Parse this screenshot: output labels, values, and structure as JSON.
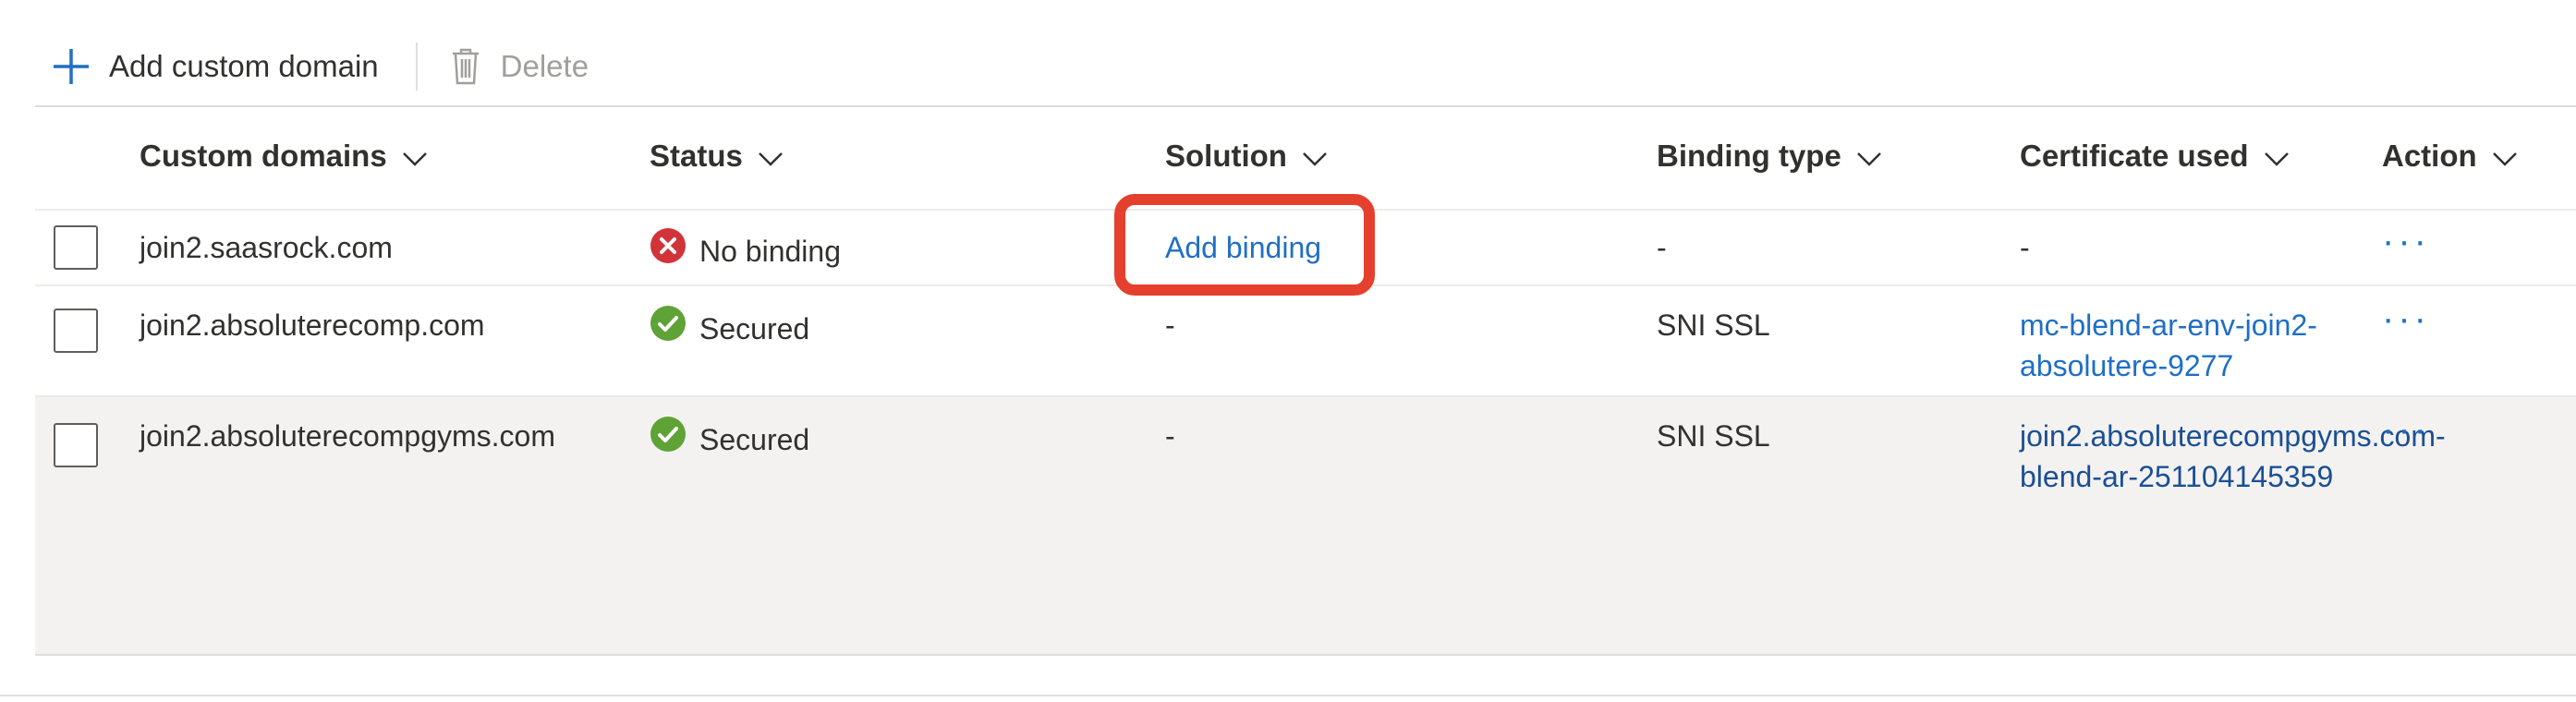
{
  "toolbar": {
    "add_label": "Add custom domain",
    "delete_label": "Delete"
  },
  "columns": {
    "domain": "Custom domains",
    "status": "Status",
    "solution": "Solution",
    "binding": "Binding type",
    "certificate": "Certificate used",
    "action": "Action"
  },
  "rows": [
    {
      "domain": "join2.saasrock.com",
      "status": "No binding",
      "status_kind": "error",
      "solution": "Add binding",
      "binding": "-",
      "certificate": "-",
      "action": "···"
    },
    {
      "domain": "join2.absoluterecomp.com",
      "status": "Secured",
      "status_kind": "success",
      "solution": "-",
      "binding": "SNI SSL",
      "certificate": "mc-blend-ar-env-join2-absolutere-9277",
      "action": "···"
    },
    {
      "domain": "join2.absoluterecompgyms.com",
      "status": "Secured",
      "status_kind": "success",
      "solution": "-",
      "binding": "SNI SSL",
      "certificate": "join2.absoluterecompgyms.com-blend-ar-251104145359",
      "action": "···"
    }
  ],
  "colors": {
    "accent": "#1f6fc5",
    "error": "#d13438",
    "success": "#5fa235",
    "highlight": "#e5402d"
  },
  "icons": {
    "add": "plus-icon",
    "delete": "trash-icon",
    "sort": "chevron-down-icon",
    "error": "error-circle-icon",
    "success": "check-circle-icon"
  }
}
